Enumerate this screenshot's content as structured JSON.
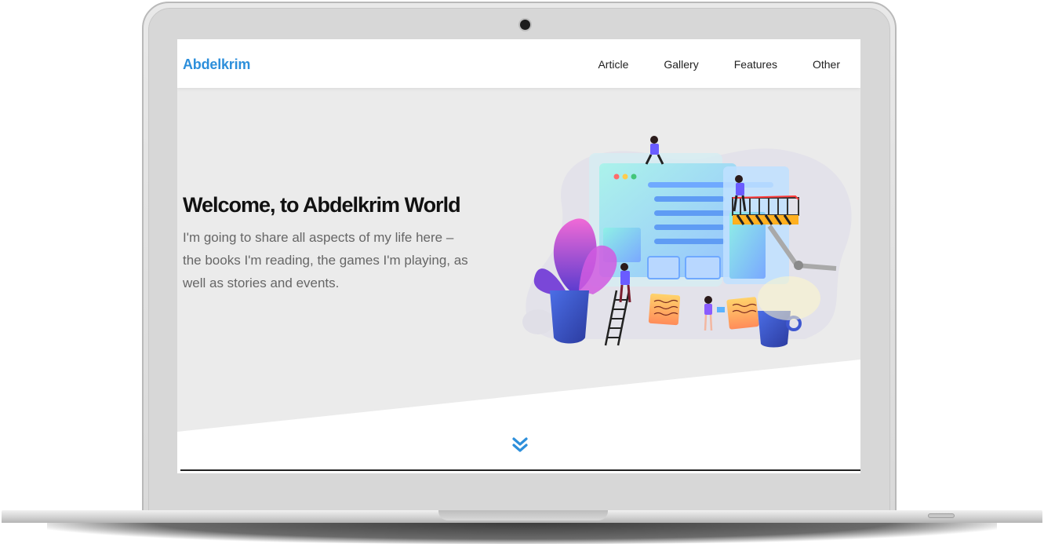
{
  "site": {
    "brand": "Abdelkrim",
    "nav": [
      "Article",
      "Gallery",
      "Features",
      "Other"
    ]
  },
  "hero": {
    "title": "Welcome, to Abdelkrim World",
    "text": "I'm going to share all aspects of my life here – the books I'm reading, the games I'm playing, as well as stories and events."
  },
  "icons": {
    "scroll": "chevrons-down-icon",
    "camera": "camera-icon"
  },
  "colors": {
    "brand": "#2d8fdb",
    "hero_bg": "#ebebeb",
    "title": "#111111",
    "text": "#666666"
  }
}
